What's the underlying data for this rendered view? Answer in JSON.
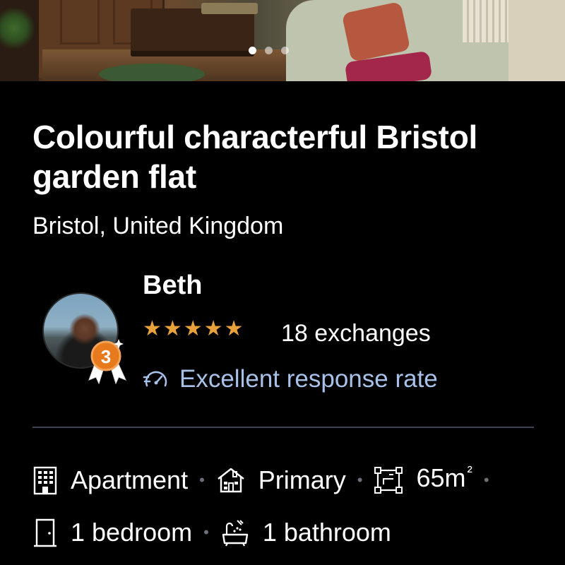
{
  "listing": {
    "title": "Colourful characterful Bristol garden flat",
    "location": "Bristol, United Kingdom"
  },
  "gallery": {
    "slides": 3,
    "active_index": 0
  },
  "host": {
    "name": "Beth",
    "rating_stars": 5,
    "stars_text": "★★★★★",
    "exchanges": "18 exchanges",
    "response": "Excellent response rate",
    "badge_level": "3"
  },
  "details": {
    "type": "Apartment",
    "residence": "Primary",
    "area_value": "65m",
    "area_unit_sup": "²",
    "bedrooms": "1 bedroom",
    "bathrooms": "1 bathroom",
    "separator": "•"
  },
  "icons": {
    "type": "building-icon",
    "residence": "house-icon",
    "area": "floorplan-icon",
    "bedrooms": "door-icon",
    "bathrooms": "bathtub-icon",
    "response": "speed-icon",
    "badge": "award-badge-icon"
  },
  "colors": {
    "background": "#000000",
    "star": "#e9a23b",
    "response": "#a8c1e8",
    "badge": "#e87a1e",
    "divider": "#3a4254"
  }
}
